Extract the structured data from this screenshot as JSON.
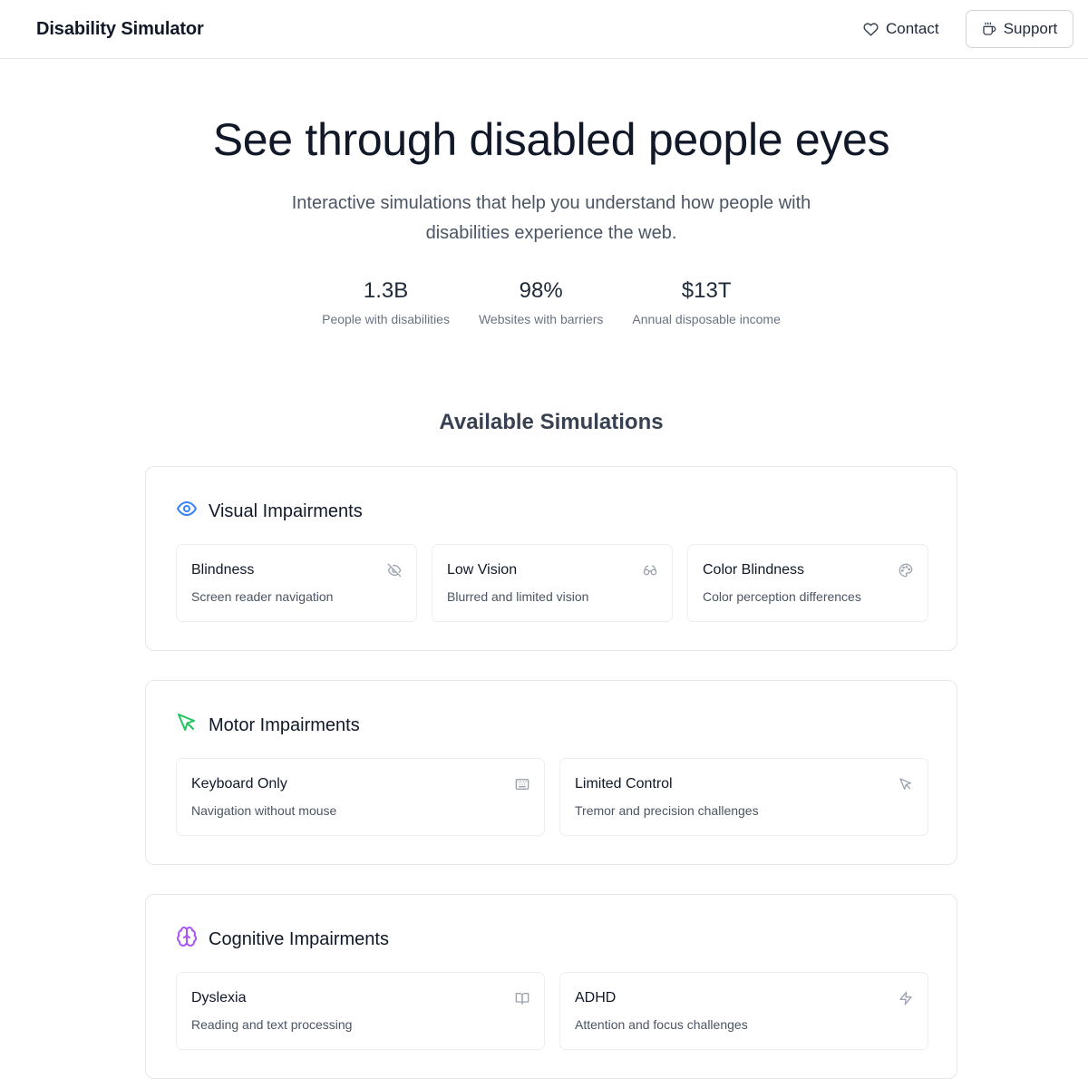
{
  "header": {
    "brand": "Disability Simulator",
    "contact_label": "Contact",
    "contact_icon": "heart-icon",
    "support_label": "Support",
    "support_icon": "coffee-icon"
  },
  "hero": {
    "title": "See through disabled people eyes",
    "subtitle": "Interactive simulations that help you understand how people with disabilities experience the web."
  },
  "stats": [
    {
      "value": "1.3B",
      "label": "People with disabilities"
    },
    {
      "value": "98%",
      "label": "Websites with barriers"
    },
    {
      "value": "$13T",
      "label": "Annual disposable income"
    }
  ],
  "section_title": "Available Simulations",
  "categories": [
    {
      "title": "Visual Impairments",
      "icon": "eye-icon",
      "color": "#3b82f6",
      "cards": [
        {
          "title": "Blindness",
          "description": "Screen reader navigation",
          "icon": "eye-off-icon"
        },
        {
          "title": "Low Vision",
          "description": "Blurred and limited vision",
          "icon": "glasses-icon"
        },
        {
          "title": "Color Blindness",
          "description": "Color perception differences",
          "icon": "palette-icon"
        }
      ]
    },
    {
      "title": "Motor Impairments",
      "icon": "pointer-icon",
      "color": "#22c55e",
      "cards": [
        {
          "title": "Keyboard Only",
          "description": "Navigation without mouse",
          "icon": "keyboard-icon"
        },
        {
          "title": "Limited Control",
          "description": "Tremor and precision challenges",
          "icon": "pointer-icon"
        }
      ]
    },
    {
      "title": "Cognitive Impairments",
      "icon": "brain-icon",
      "color": "#a855f7",
      "cards": [
        {
          "title": "Dyslexia",
          "description": "Reading and text processing",
          "icon": "book-icon"
        },
        {
          "title": "ADHD",
          "description": "Attention and focus challenges",
          "icon": "zap-icon"
        }
      ]
    }
  ]
}
